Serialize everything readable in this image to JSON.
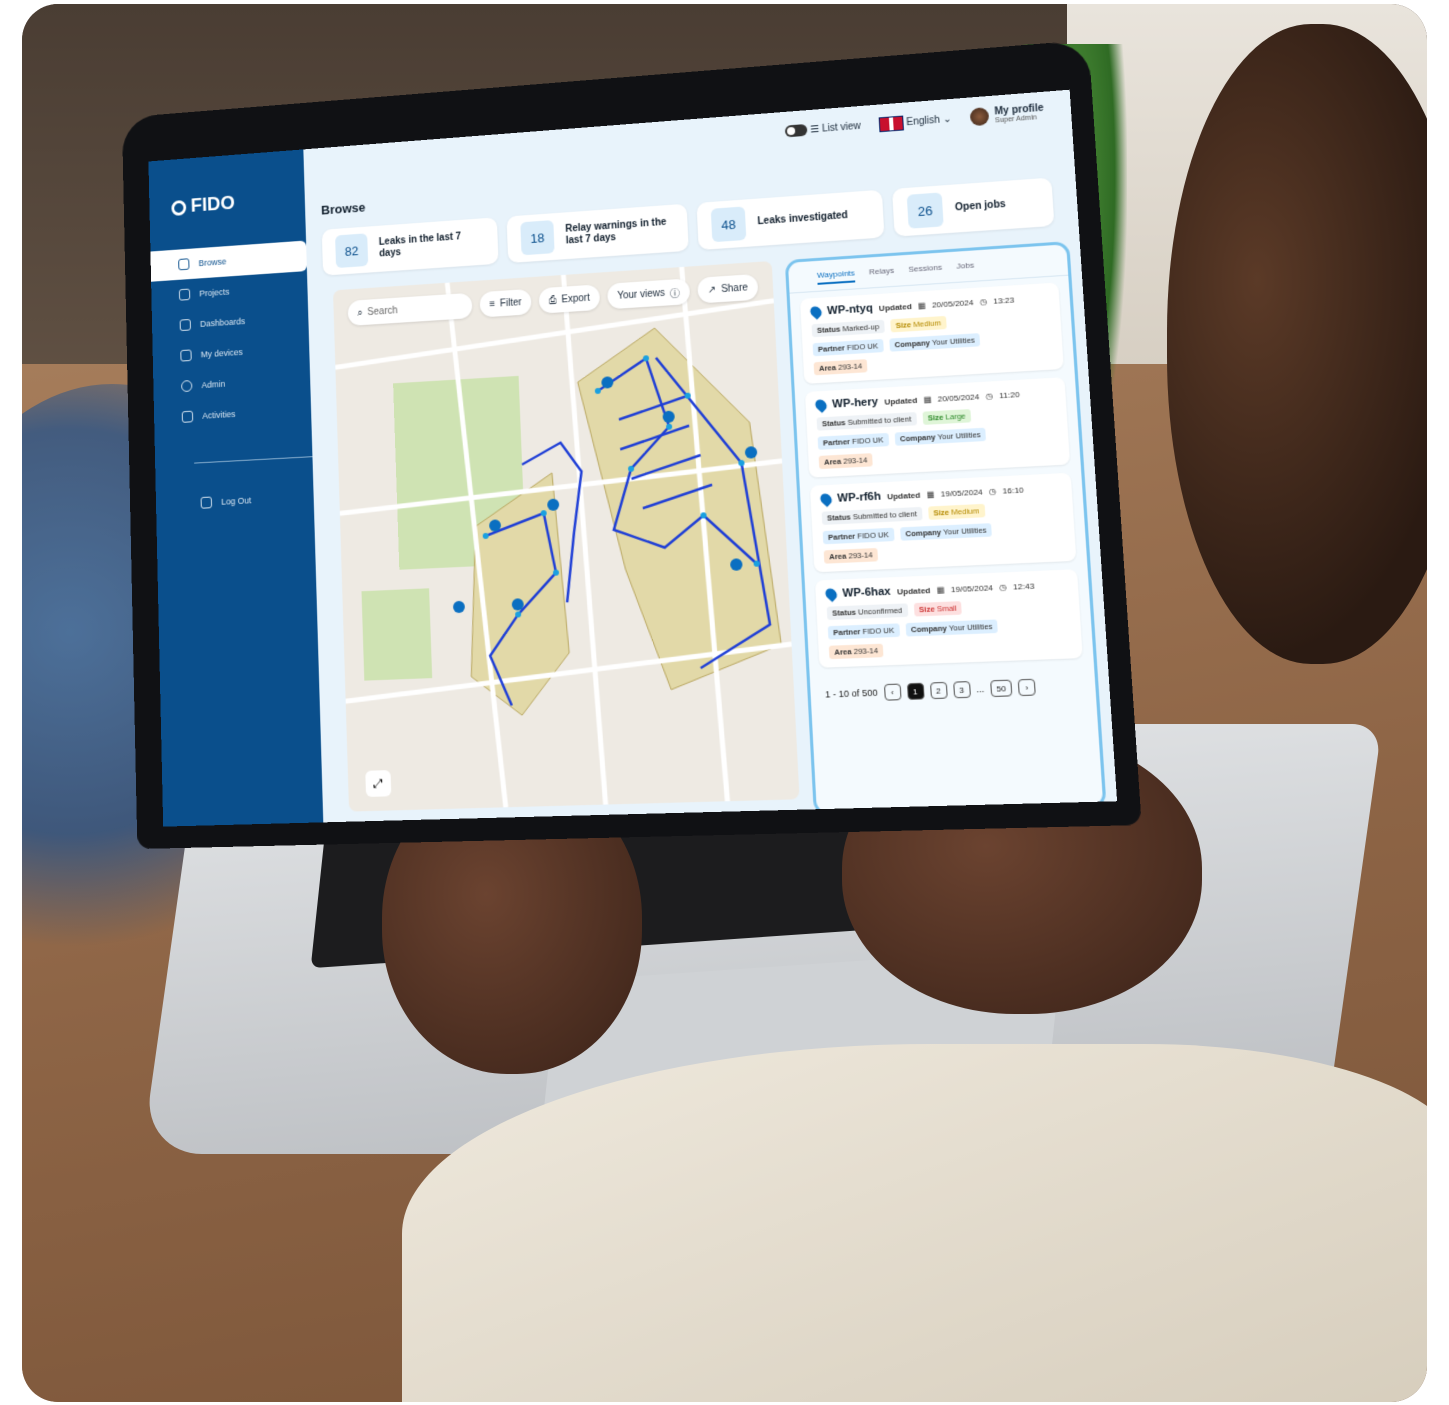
{
  "app": {
    "name": "FIDO"
  },
  "topbar": {
    "list_view": "List view",
    "language": "English",
    "profile_name": "My profile",
    "profile_role": "Super Admin"
  },
  "sidebar": {
    "items": [
      {
        "label": "Browse"
      },
      {
        "label": "Projects"
      },
      {
        "label": "Dashboards"
      },
      {
        "label": "My devices"
      },
      {
        "label": "Admin"
      },
      {
        "label": "Activities"
      }
    ],
    "logout": "Log Out"
  },
  "page": {
    "title": "Browse"
  },
  "stats": [
    {
      "value": "82",
      "label": "Leaks in the last 7 days"
    },
    {
      "value": "18",
      "label": "Relay warnings in the last 7 days"
    },
    {
      "value": "48",
      "label": "Leaks investigated"
    },
    {
      "value": "26",
      "label": "Open jobs"
    }
  ],
  "map_toolbar": {
    "search_placeholder": "Search",
    "filter": "Filter",
    "export": "Export",
    "your_views": "Your views",
    "share": "Share"
  },
  "panel": {
    "tabs": [
      "Waypoints",
      "Relays",
      "Sessions",
      "Jobs"
    ],
    "labels": {
      "updated": "Updated",
      "status": "Status",
      "size": "Size",
      "partner": "Partner",
      "company": "Company",
      "area": "Area"
    },
    "cards": [
      {
        "id": "WP-ntyq",
        "date": "20/05/2024",
        "time": "13:23",
        "status": "Marked-up",
        "size": "Medium",
        "partner": "FIDO UK",
        "company": "Your Utilities",
        "area": "293-14"
      },
      {
        "id": "WP-hery",
        "date": "20/05/2024",
        "time": "11:20",
        "status": "Submitted to client",
        "size": "Large",
        "partner": "FIDO UK",
        "company": "Your Utilities",
        "area": "293-14"
      },
      {
        "id": "WP-rf6h",
        "date": "19/05/2024",
        "time": "16:10",
        "status": "Submitted to client",
        "size": "Medium",
        "partner": "FIDO UK",
        "company": "Your Utilities",
        "area": "293-14"
      },
      {
        "id": "WP-6hax",
        "date": "19/05/2024",
        "time": "12:43",
        "status": "Unconfirmed",
        "size": "Small",
        "partner": "FIDO UK",
        "company": "Your Utilities",
        "area": "293-14"
      }
    ],
    "pagination": {
      "range": "1 - 10 of 500",
      "pages": [
        "1",
        "2",
        "3"
      ],
      "ellipsis": "...",
      "last": "50"
    }
  },
  "colors": {
    "sidebar": "#0a4f8c",
    "accent": "#0a6fc1",
    "route": "#1f3fd6"
  }
}
